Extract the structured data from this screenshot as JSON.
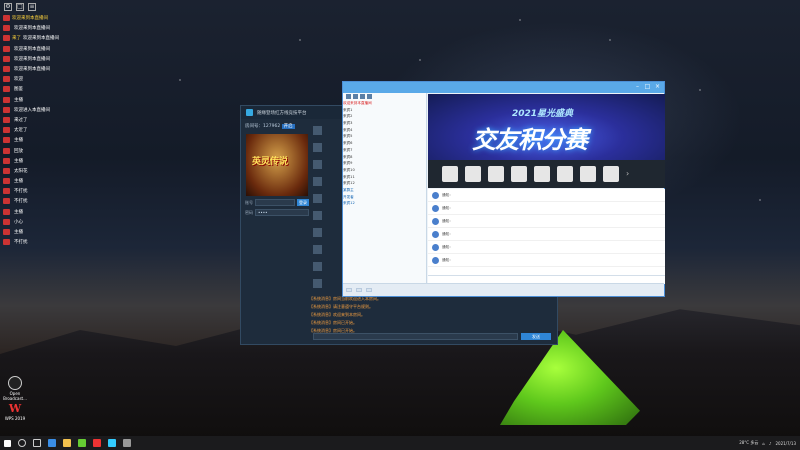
{
  "desktop": {
    "icons": [
      {
        "label": "Open Broadcast...",
        "icon": "obs-icon"
      },
      {
        "label": "WPS 2019",
        "icon": "wps-icon"
      }
    ]
  },
  "chat_overlay": {
    "messages": [
      {
        "nick": "欢迎来到本直播间"
      },
      {
        "nick": "",
        "text": "欢迎来到本直播间"
      },
      {
        "nick": "来了",
        "text": "欢迎来到本直播间"
      },
      {
        "nick": "",
        "text": "欢迎来到本直播间"
      },
      {
        "nick": "",
        "text": "欢迎来到本直播间"
      },
      {
        "nick": "",
        "text": "欢迎来到本直播间"
      },
      {
        "nick": "",
        "text": "欢迎"
      },
      {
        "nick": "",
        "text": "图鉴"
      },
      {
        "nick": "",
        "text": "主播"
      },
      {
        "nick": "",
        "text": "欢迎进入本直播间"
      },
      {
        "nick": "",
        "text": "来过了"
      },
      {
        "nick": "",
        "text": "太近了"
      },
      {
        "nick": "",
        "text": "主播"
      },
      {
        "nick": "",
        "text": "回放"
      },
      {
        "nick": "",
        "text": "主播"
      },
      {
        "nick": "",
        "text": "太阳花"
      },
      {
        "nick": "",
        "text": "主播"
      },
      {
        "nick": "",
        "text": "不打扰"
      },
      {
        "nick": "",
        "text": "不打扰"
      },
      {
        "nick": "",
        "text": "主播"
      },
      {
        "nick": "",
        "text": "小心"
      },
      {
        "nick": "",
        "text": "主播"
      },
      {
        "nick": "",
        "text": "不打扰"
      }
    ]
  },
  "game_window": {
    "title": "随缘登场红方线竞技平台",
    "room_label": "房间号：127962",
    "room_tag": "开启",
    "poster_title": "英灵传说",
    "form": {
      "account_label": "账号",
      "account_value": "",
      "button": "登录",
      "password_label": "密码",
      "password_value": "••••"
    },
    "system_messages": [
      "【系统消息】房间当前欢迎进入本房间。",
      "【系统消息】请注意遵守平台规则。",
      "【系统消息】欢迎来到本房间。",
      "【系统消息】房间已开始。",
      "【系统消息】房间已开始。"
    ],
    "input_placeholder": "",
    "send_label": "发送"
  },
  "qq_window": {
    "title": "",
    "tree_nodes": [
      "欢迎来到本直播间",
      "来宾1",
      "来宾2",
      "来宾3",
      "来宾4",
      "来宾5",
      "来宾6",
      "来宾7",
      "来宾8",
      "来宾9",
      "来宾10",
      "来宾11",
      "来宾12",
      "某群主",
      "开发者",
      "来宾12"
    ],
    "banner_line1": "2021星光盛典",
    "banner_line2": "交友积分赛",
    "messages": [
      "通知：",
      "通知：",
      "通知：",
      "通知：",
      "通知：",
      "通知："
    ],
    "input_placeholder": "",
    "bottom_buttons": [
      "",
      "",
      ""
    ]
  },
  "taskbar": {
    "weather": "28°C 多云",
    "time": "",
    "date": "2021/7/13"
  }
}
